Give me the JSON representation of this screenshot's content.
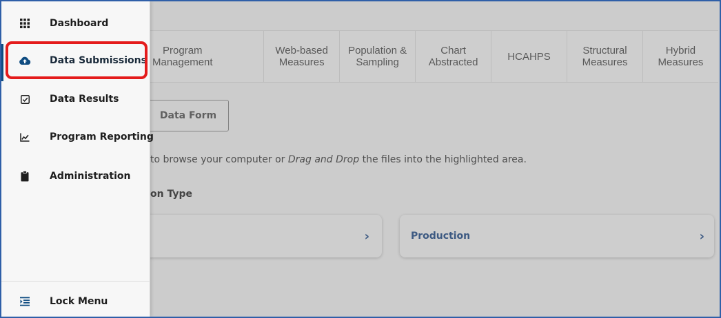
{
  "tabs": [
    {
      "id": "program-management",
      "label": "Program\nManagement"
    },
    {
      "id": "web-based-measures",
      "label": "Web-based\nMeasures"
    },
    {
      "id": "population-sampling",
      "label": "Population &\nSampling"
    },
    {
      "id": "chart-abstracted",
      "label": "Chart\nAbstracted"
    },
    {
      "id": "hcahps",
      "label": "HCAHPS"
    },
    {
      "id": "structural-measures",
      "label": "Structural\nMeasures"
    },
    {
      "id": "hybrid-measures",
      "label": "Hybrid\nMeasures"
    }
  ],
  "main": {
    "data_form_button": "Data Form",
    "instructions_pre": "to browse your computer or ",
    "instructions_em": "Drag and Drop",
    "instructions_post": " the files into the highlighted area.",
    "submission_type_label": "on Type",
    "cards": {
      "test_label": "",
      "production_label": "Production",
      "chevron": "›"
    }
  },
  "sidebar": {
    "items": [
      {
        "id": "dashboard",
        "label": "Dashboard",
        "icon": "grid-icon"
      },
      {
        "id": "data-submissions",
        "label": "Data Submissions",
        "icon": "cloud-upload-icon",
        "active": true
      },
      {
        "id": "data-results",
        "label": "Data Results",
        "icon": "checkbox-icon"
      },
      {
        "id": "program-reporting",
        "label": "Program Reporting",
        "icon": "line-chart-icon"
      },
      {
        "id": "administration",
        "label": "Administration",
        "icon": "clipboard-icon"
      }
    ],
    "lock_menu": {
      "label": "Lock Menu",
      "icon": "menu-lock-icon"
    }
  },
  "colors": {
    "accent": "#0f4c81",
    "highlight": "#e41b1b",
    "link": "#1f4a86"
  }
}
